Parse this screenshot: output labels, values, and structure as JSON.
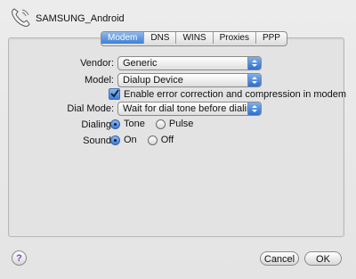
{
  "window": {
    "title": "SAMSUNG_Android",
    "icon": "phone-icon"
  },
  "tabs": [
    {
      "label": "Modem",
      "active": true
    },
    {
      "label": "DNS",
      "active": false
    },
    {
      "label": "WINS",
      "active": false
    },
    {
      "label": "Proxies",
      "active": false
    },
    {
      "label": "PPP",
      "active": false
    }
  ],
  "form": {
    "vendor_label": "Vendor:",
    "vendor_value": "Generic",
    "model_label": "Model:",
    "model_value": "Dialup Device",
    "error_correction_label": "Enable error correction and compression in modem",
    "error_correction_checked": true,
    "dial_mode_label": "Dial Mode:",
    "dial_mode_value": "Wait for dial tone before dialing",
    "dialing_label": "Dialing:",
    "dialing_options": [
      {
        "label": "Tone",
        "selected": true
      },
      {
        "label": "Pulse",
        "selected": false
      }
    ],
    "sound_label": "Sound:",
    "sound_options": [
      {
        "label": "On",
        "selected": true
      },
      {
        "label": "Off",
        "selected": false
      }
    ]
  },
  "footer": {
    "help_label": "?",
    "cancel_label": "Cancel",
    "ok_label": "OK"
  },
  "colors": {
    "accent": "#3d7fd8",
    "panel": "#e3e3e3"
  }
}
